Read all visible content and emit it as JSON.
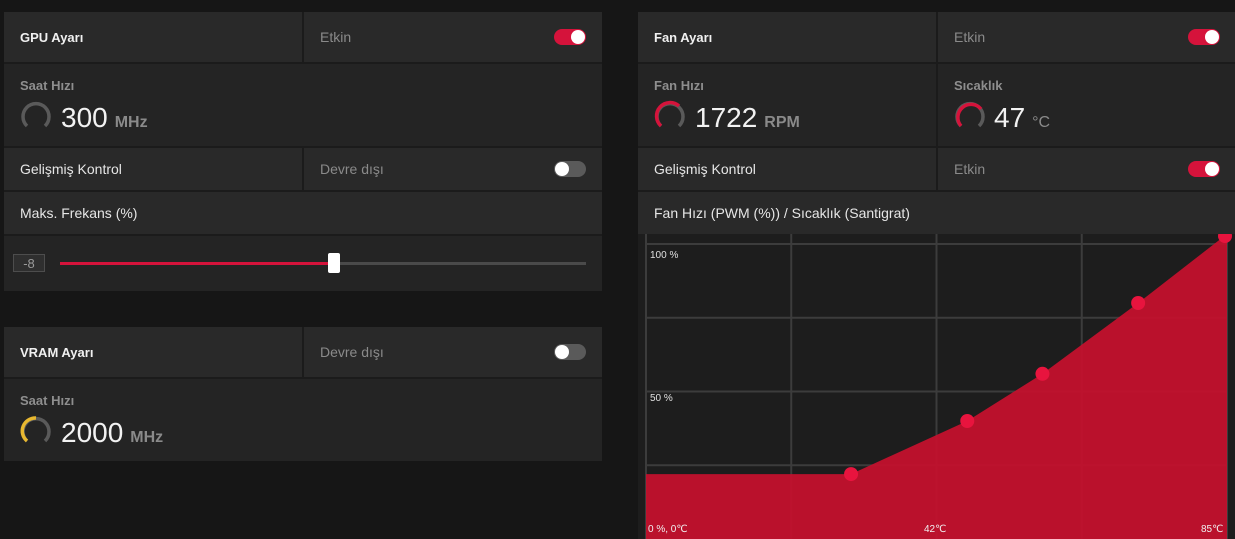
{
  "gpu": {
    "title": "GPU Ayarı",
    "status": "Etkin",
    "enabled": true,
    "clock": {
      "label": "Saat Hızı",
      "value": "300",
      "unit": "MHz"
    },
    "advanced": {
      "label": "Gelişmiş Kontrol",
      "status": "Devre dışı",
      "enabled": false
    },
    "max_freq": {
      "label": "Maks. Frekans (%)",
      "value": "-8",
      "level": 0.52
    }
  },
  "vram": {
    "title": "VRAM Ayarı",
    "status": "Devre dışı",
    "enabled": false,
    "clock": {
      "label": "Saat Hızı",
      "value": "2000",
      "unit": "MHz"
    }
  },
  "fan": {
    "title": "Fan Ayarı",
    "status": "Etkin",
    "enabled": true,
    "speed": {
      "label": "Fan Hızı",
      "value": "1722",
      "unit": "RPM"
    },
    "temp": {
      "label": "Sıcaklık",
      "value": "47",
      "unit": "°C"
    },
    "advanced": {
      "label": "Gelişmiş Kontrol",
      "status": "Etkin",
      "enabled": true
    },
    "chart_title": "Fan Hızı (PWM (%)) / Sıcaklık (Santigrat)"
  },
  "colors": {
    "accent": "#d5133b",
    "gauge_yellow": "#e8b830",
    "gauge_idle": "#5a5a5a"
  },
  "chart_data": {
    "type": "area",
    "xlabel": "Sıcaklık (Santigrat)",
    "ylabel": "Fan Hızı (PWM (%))",
    "xlim": [
      0,
      85
    ],
    "ylim": [
      0,
      100
    ],
    "tick_labels": {
      "y_top": "100 %",
      "y_mid": "50 %",
      "origin": "0 %, 0℃",
      "x_mid": "42℃",
      "x_end": "85℃"
    },
    "points": [
      {
        "x": 0,
        "y": 22
      },
      {
        "x": 30,
        "y": 22
      },
      {
        "x": 47,
        "y": 40
      },
      {
        "x": 58,
        "y": 56
      },
      {
        "x": 72,
        "y": 80
      },
      {
        "x": 85,
        "y": 104
      }
    ],
    "grid": true
  }
}
